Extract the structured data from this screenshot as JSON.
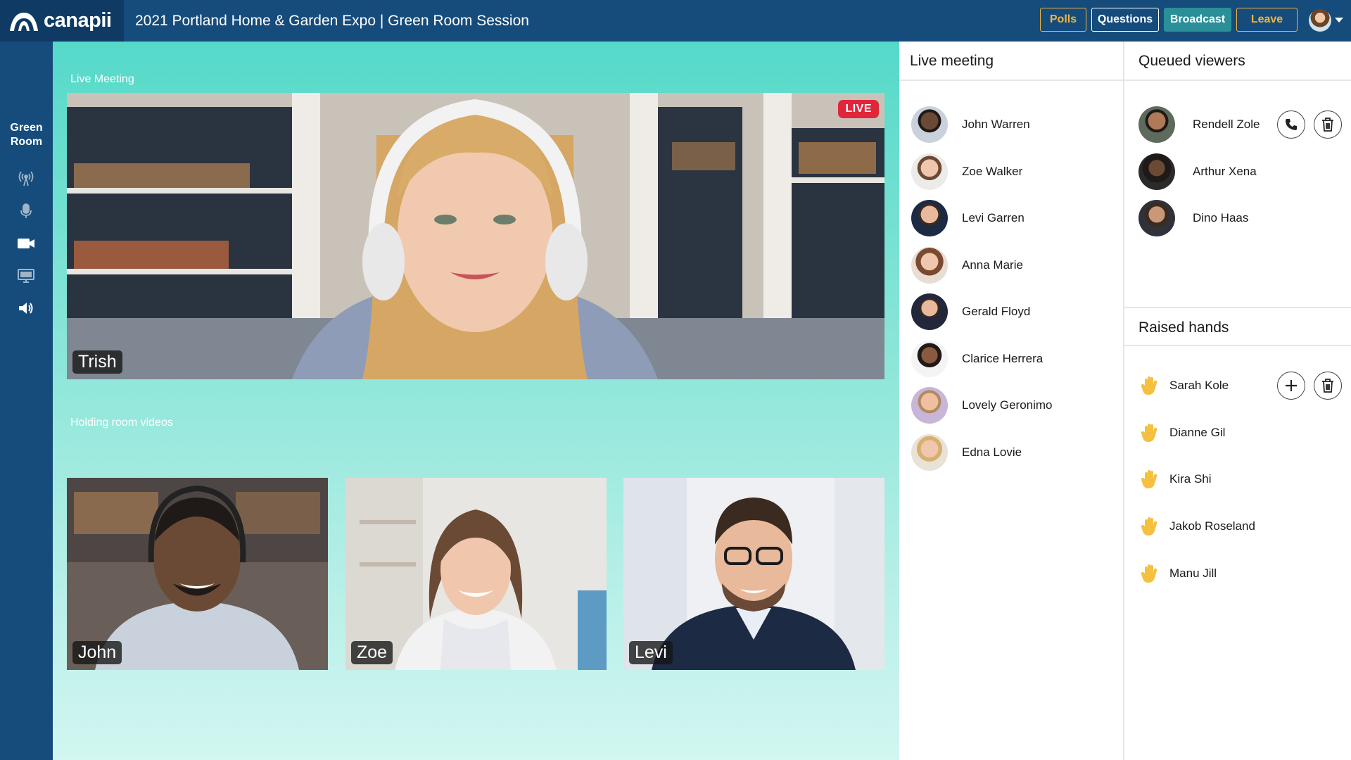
{
  "app": {
    "logo_text": "canapii",
    "title": "2021 Portland Home & Garden Expo | Green Room Session"
  },
  "toolbar": {
    "polls": "Polls",
    "questions": "Questions",
    "broadcast": "Broadcast",
    "leave": "Leave"
  },
  "leftrail": {
    "label": "Green Room",
    "icons": [
      "broadcast-icon",
      "microphone-icon",
      "camera-icon",
      "screen-share-icon",
      "speaker-icon"
    ]
  },
  "main": {
    "live_label": "Live Meeting",
    "live_badge": "LIVE",
    "live_speaker": "Trish",
    "holding_label": "Holding room videos",
    "holding": [
      "John",
      "Zoe",
      "Levi"
    ]
  },
  "live_meeting": {
    "title": "Live meeting",
    "people": [
      "John Warren",
      "Zoe Walker",
      "Levi Garren",
      "Anna Marie",
      "Gerald Floyd",
      "Clarice Herrera",
      "Lovely Geronimo",
      "Edna Lovie"
    ]
  },
  "queued": {
    "title": "Queued viewers",
    "people": [
      "Rendell Zole",
      "Arthur Xena",
      "Dino Haas"
    ]
  },
  "raised": {
    "title": "Raised hands",
    "people": [
      "Sarah Kole",
      "Dianne Gil",
      "Kira Shi",
      "Jakob Roseland",
      "Manu Jill"
    ]
  },
  "colors": {
    "nav": "#164c7c",
    "accent_yellow": "#f3b43a",
    "broadcast": "#2b8f99",
    "live_red": "#e0263a",
    "hand": "#f5c040"
  }
}
